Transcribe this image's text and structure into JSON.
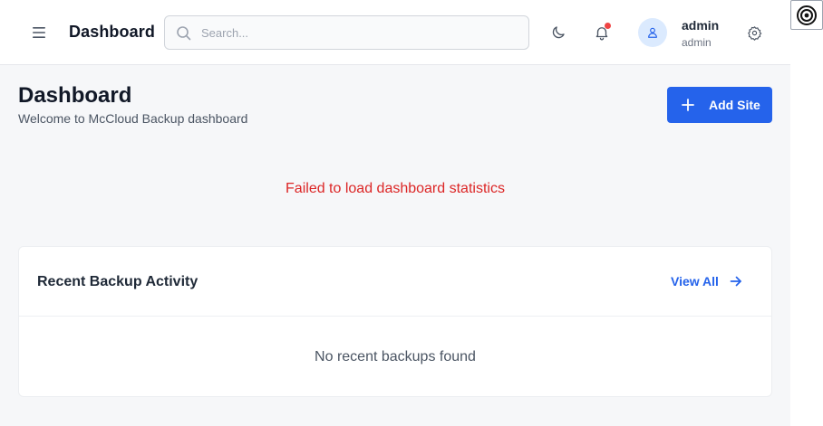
{
  "header": {
    "app_title": "Dashboard",
    "search_placeholder": "Search...",
    "search_value": "",
    "notification_badge_color": "#ef4444",
    "user": {
      "name": "admin",
      "role": "admin"
    },
    "icons": [
      "menu-icon",
      "search-icon",
      "moon-icon",
      "bell-icon",
      "user-icon",
      "gear-icon"
    ]
  },
  "page": {
    "title": "Dashboard",
    "subtitle": "Welcome to McCloud Backup dashboard",
    "add_site_label": "Add Site",
    "error_message": "Failed to load dashboard statistics"
  },
  "recent_activity": {
    "title": "Recent Backup Activity",
    "view_all_label": "View All",
    "empty_message": "No recent backups found"
  },
  "colors": {
    "accent": "#2563eb",
    "error": "#dc2626",
    "background": "#f6f7f9"
  }
}
